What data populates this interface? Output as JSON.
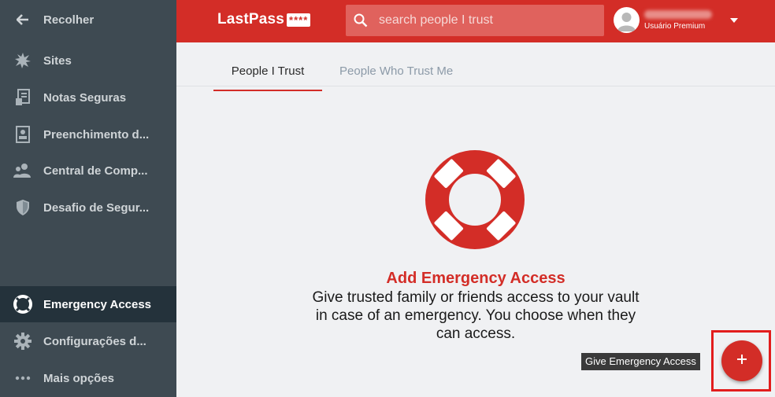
{
  "sidebar": {
    "collapse_label": "Recolher",
    "items": [
      {
        "label": "Sites",
        "icon": "puzzle-icon"
      },
      {
        "label": "Notas Seguras",
        "icon": "note-icon"
      },
      {
        "label": "Preenchimento d...",
        "icon": "form-fill-icon"
      },
      {
        "label": "Central de Comp...",
        "icon": "sharing-center-icon"
      },
      {
        "label": "Desafio de Segur...",
        "icon": "shield-icon"
      }
    ],
    "bottom_items": [
      {
        "label": "Emergency Access",
        "icon": "lifebuoy-icon",
        "active": true
      },
      {
        "label": "Configurações d...",
        "icon": "gear-icon"
      },
      {
        "label": "Mais opções",
        "icon": "more-dots-icon"
      }
    ]
  },
  "header": {
    "logo_text": "LastPass",
    "logo_stars": "****",
    "search_placeholder": "search people I trust",
    "user_tier": "Usuário Premium"
  },
  "tabs": [
    {
      "label": "People I Trust",
      "active": true
    },
    {
      "label": "People Who Trust Me",
      "active": false
    }
  ],
  "empty_state": {
    "icon": "lifebuoy-icon",
    "title": "Add Emergency Access",
    "description": "Give trusted family or friends access to your vault in case of an emergency. You choose when they can access."
  },
  "fab": {
    "tooltip": "Give Emergency Access",
    "icon": "plus-icon"
  },
  "colors": {
    "brand_red": "#d32d27",
    "sidebar_bg": "#3e4a52",
    "sidebar_active": "#24323b"
  }
}
